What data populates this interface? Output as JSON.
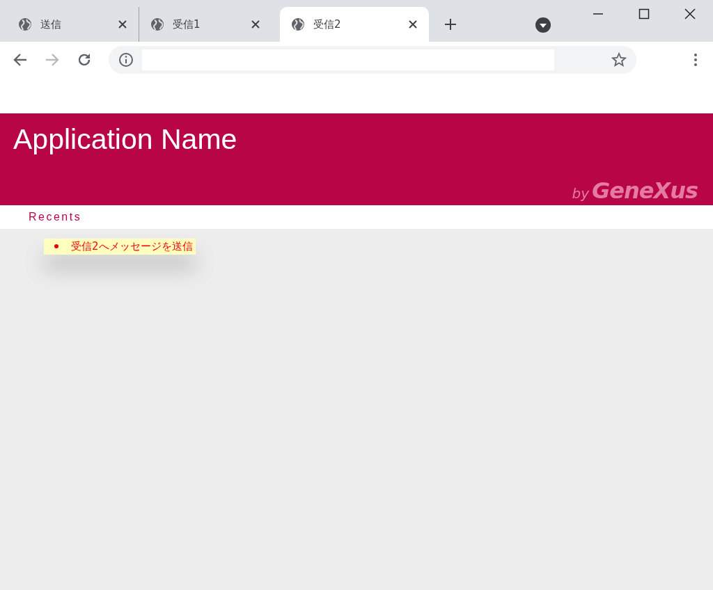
{
  "browser": {
    "tabs": [
      {
        "title": "送信",
        "selected": false
      },
      {
        "title": "受信1",
        "selected": false
      },
      {
        "title": "受信2",
        "selected": true
      }
    ],
    "forward_disabled": true
  },
  "header": {
    "title": "Application Name",
    "logo_by": "by",
    "logo_brand": "GeneXus"
  },
  "nav": {
    "label": "Recents"
  },
  "messages": [
    {
      "text": "受信2へメッセージを送信"
    }
  ]
}
